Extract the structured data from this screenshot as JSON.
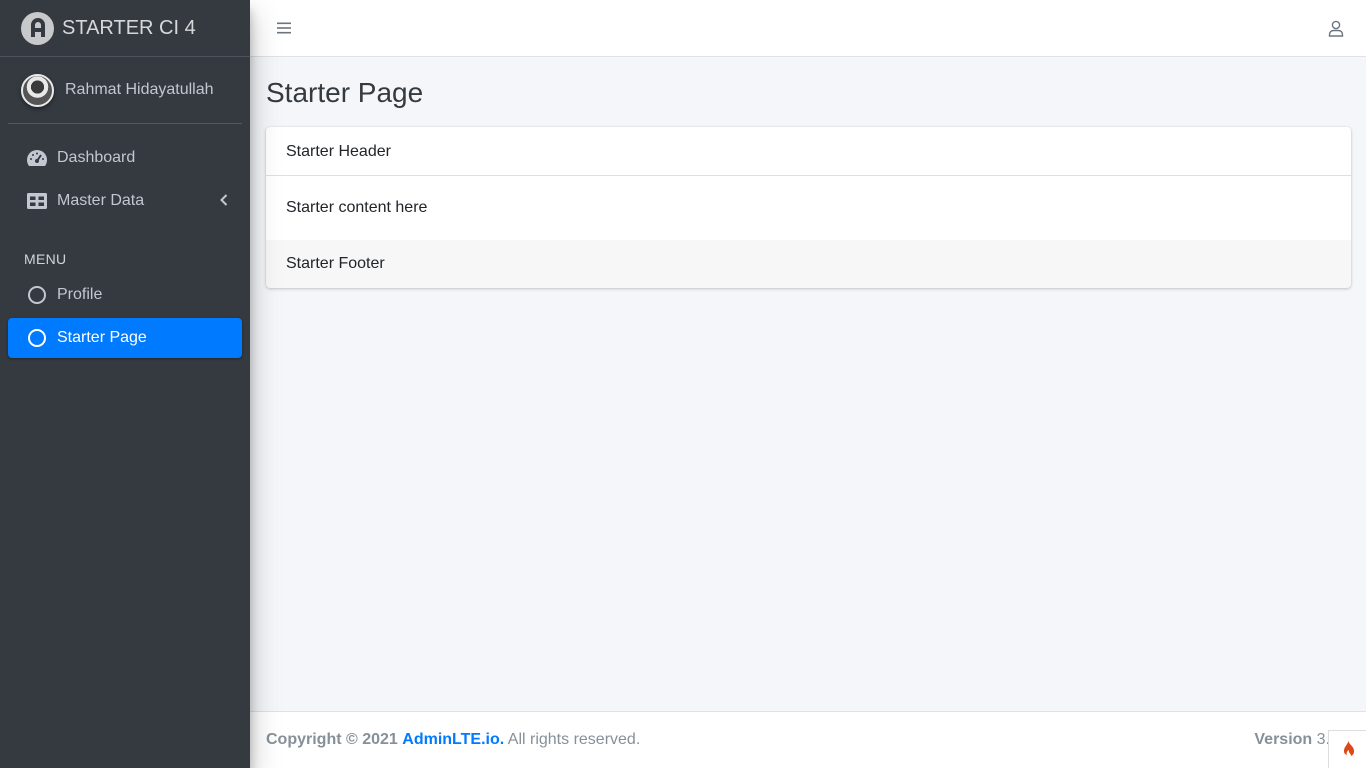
{
  "brand": {
    "title": "STARTER CI 4"
  },
  "user": {
    "name": "Rahmat Hidayatullah"
  },
  "sidebar": {
    "items": [
      {
        "label": "Dashboard",
        "icon": "tachometer-icon"
      },
      {
        "label": "Master Data",
        "icon": "table-icon",
        "has_submenu": true
      }
    ],
    "header": "MENU",
    "menu_items": [
      {
        "label": "Profile",
        "icon": "circle-icon",
        "active": false
      },
      {
        "label": "Starter Page",
        "icon": "circle-icon",
        "active": true
      }
    ]
  },
  "navbar": {
    "toggle_icon": "bars-icon",
    "user_icon": "user-icon"
  },
  "main": {
    "title": "Starter Page",
    "card": {
      "header": "Starter Header",
      "body": "Starter content here",
      "footer": "Starter Footer"
    }
  },
  "footer": {
    "copyright": "Copyright © 2021",
    "link": "AdminLTE.io.",
    "rights": "All rights reserved.",
    "version_label": "Version",
    "version_value": "3."
  },
  "colors": {
    "accent": "#007bff",
    "sidebar_bg": "#343a40",
    "content_bg": "#f4f6f9"
  }
}
